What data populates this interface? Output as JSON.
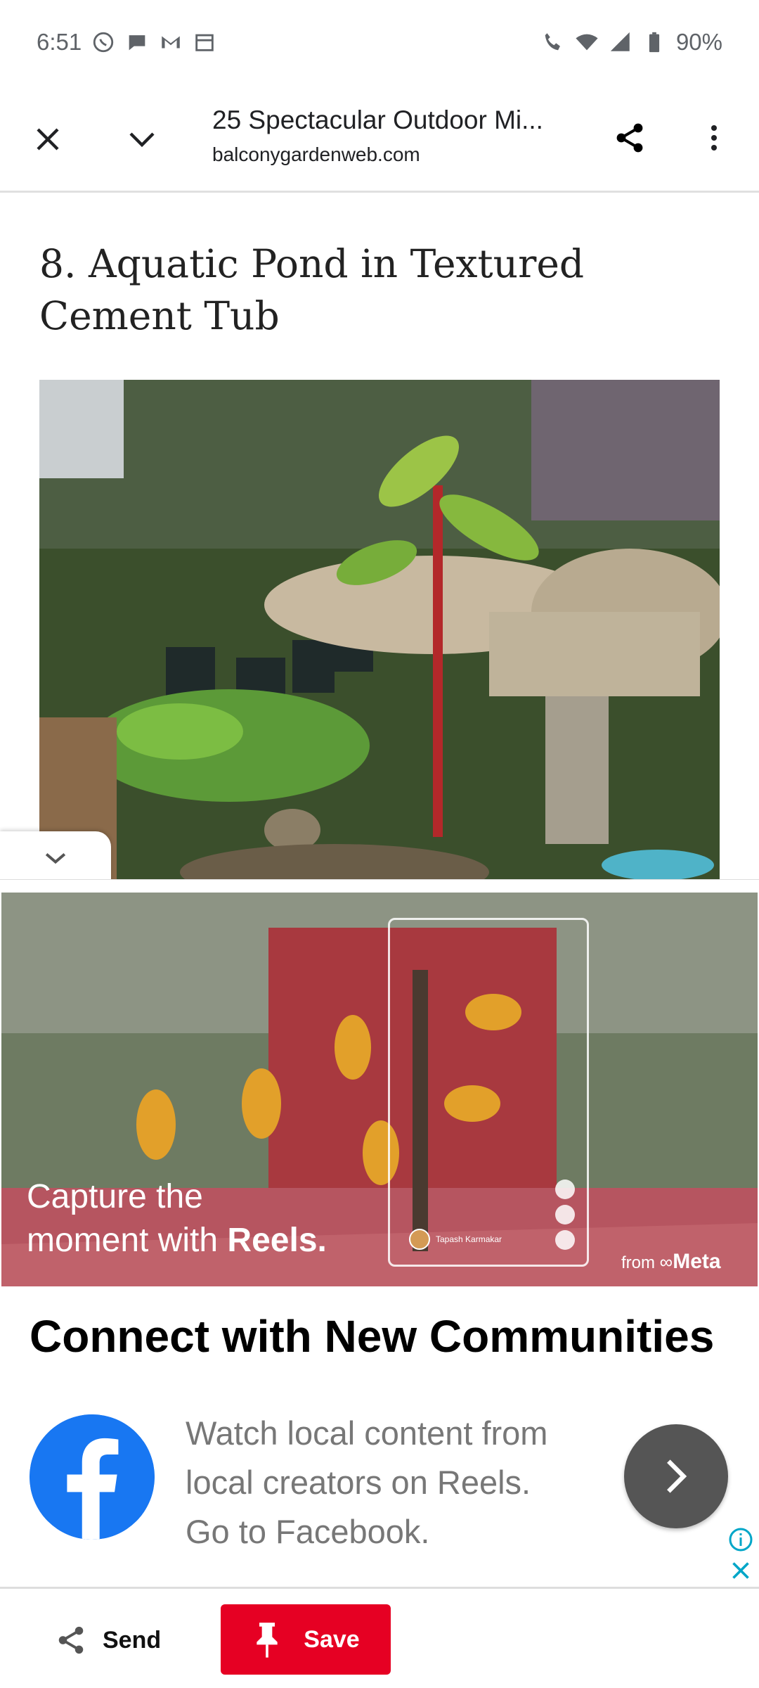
{
  "status_bar": {
    "time": "6:51",
    "battery": "90%",
    "icons": [
      "whatsapp-icon",
      "chat-icon",
      "gmail-icon",
      "calendar-icon",
      "wifi-calling-icon",
      "wifi-icon",
      "signal-icon",
      "battery-icon"
    ]
  },
  "browser_toolbar": {
    "title": "25 Spectacular Outdoor Mi...",
    "domain": "balconygardenweb.com",
    "icons": [
      "close-icon",
      "chevron-down-icon",
      "share-icon",
      "more-vertical-icon"
    ]
  },
  "article": {
    "heading": "8. Aquatic Pond in Textured Cement Tub"
  },
  "ad": {
    "creative": {
      "tagline_line1": "Capture the",
      "tagline_line2_prefix": "moment with ",
      "tagline_line2_bold": "Reels.",
      "reel_username": "Tapash Karmakar",
      "meta_prefix": "from ",
      "meta_brand": "Meta"
    },
    "headline": "Connect with New Communities",
    "body_line1": "Watch local content from",
    "body_line2": "local creators on Reels.",
    "body_line3": "Go to Facebook.",
    "colors": {
      "facebook_blue": "#1877f2",
      "cta_gray": "#555555",
      "adchoices_teal": "#00a6c8"
    }
  },
  "bottom_bar": {
    "send_label": "Send",
    "save_label": "Save",
    "colors": {
      "save_red": "#e60023"
    }
  }
}
